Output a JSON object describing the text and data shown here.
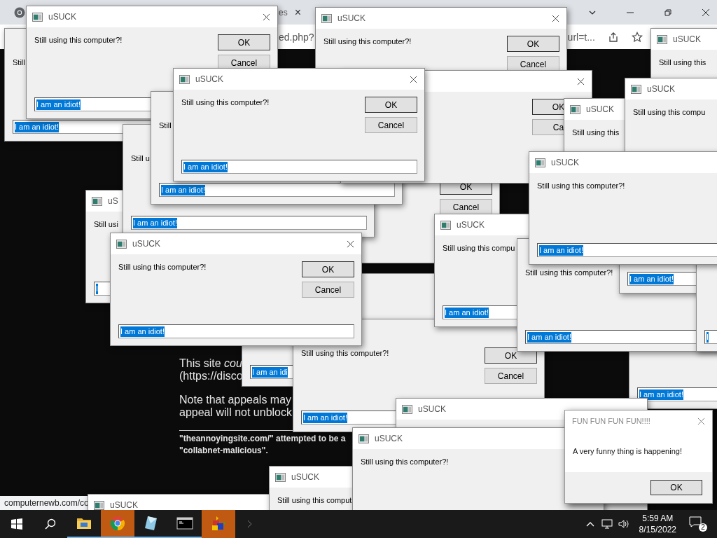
{
  "browser": {
    "tab_text": "es",
    "tab_close": "×",
    "address_left": "ed.php?",
    "address_right": "url=t...",
    "status": "computernewb.com/co"
  },
  "page": {
    "paragraphs": [
      [
        "This site *cou*",
        "(https://disco"
      ],
      [
        "Note that appeals may",
        "appeal will not unblock"
      ]
    ],
    "footer": [
      "\"theannoyingsite.com/\" attempted to be a",
      "\"collabnet-malicious\"."
    ]
  },
  "dialogs": [
    {
      "title": "uSUCK",
      "close": true,
      "message": "Still using this computer?!",
      "ok": "OK",
      "cancel": "Cancel",
      "field_value": "I am an idiot!"
    },
    {
      "title": "uSUCK",
      "close": true,
      "message": "Still using this computer?!",
      "ok": "OK",
      "cancel": "Cancel"
    },
    {
      "message": "Still",
      "field_value": "I am an idiot!"
    },
    {
      "title": "uSUCK",
      "message": "Still using this"
    },
    {
      "title": "uSUCK",
      "close": true,
      "message": "Still using this computer?!",
      "ok": "OK",
      "cancel": "Cancel",
      "field_value": "I am an idiot!"
    },
    {
      "close": true,
      "ok": "OK",
      "cancel": "Ca"
    },
    {
      "title": "uSUCK",
      "message": "Still using this compu"
    },
    {
      "message": "Still",
      "field_value": "I am an idiot!"
    },
    {
      "title": "uSUCK",
      "message": "Still using this"
    },
    {
      "message": "Still u",
      "field_value": "I am an idiot!"
    },
    {
      "ok": "OK",
      "cancel": "Cancel"
    },
    {
      "title": "uSUCK",
      "message": "Still using this computer?!",
      "field_value": "I am an idiot!"
    },
    {
      "field_value": "I am an idiot!"
    },
    {
      "title": "uS",
      "message": "Still usi",
      "field_value": "I"
    },
    {
      "title": "uSUCK",
      "message": "Still using this compu",
      "field_value": "I am an idiot!"
    },
    {
      "title": "uSUCK",
      "close": true,
      "message": "Still using this computer?!",
      "ok": "OK",
      "cancel": "Cancel",
      "field_value": "I am an idiot!"
    },
    {
      "message": "Still using this computer?!",
      "field_value": "I am an idiot!"
    },
    {
      "field_value": "I"
    },
    {
      "field_value": "I am an idi"
    },
    {
      "field_value": "I am an idiot!"
    },
    {
      "message": "Still using this computer?!",
      "ok": "OK",
      "cancel": "Cancel",
      "field_value": "I am an idiot!"
    },
    {
      "title": "uSUCK"
    },
    {
      "title": "uSUCK",
      "message": "Still using this computer?!"
    },
    {
      "title": "uSUCK",
      "message": "Still using this comput"
    },
    {
      "title": "uSUCK"
    }
  ],
  "alert": {
    "title": "FUN FUN FUN FUN!!!!",
    "message": "A very funny thing is happening!",
    "button": "OK"
  },
  "taskbar": {
    "apps": [
      {
        "kind": "folder",
        "running": true,
        "flashing": false
      },
      {
        "kind": "chrome",
        "running": true,
        "flashing": true
      },
      {
        "kind": "notepad",
        "running": true,
        "flashing": false
      },
      {
        "kind": "terminal",
        "running": true,
        "flashing": false
      },
      {
        "kind": "cubes",
        "running": false,
        "flashing": true
      }
    ],
    "time": "5:59 AM",
    "date": "8/15/2022",
    "notifications": "2"
  }
}
